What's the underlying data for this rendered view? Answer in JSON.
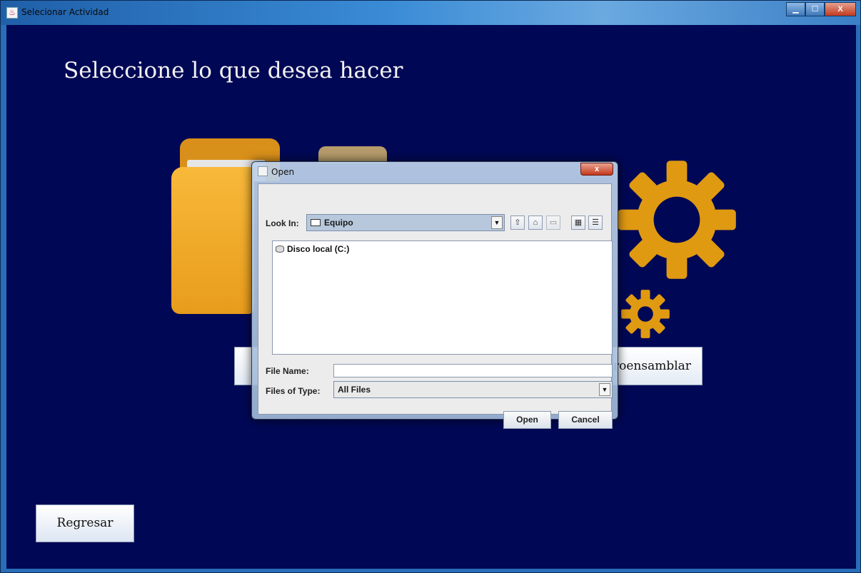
{
  "window": {
    "title": "Selecionar Actividad",
    "controls": {
      "minimize": "▁",
      "maximize": "☐",
      "close": "X"
    }
  },
  "main": {
    "heading": "Seleccione lo que desea hacer",
    "option_right_label": "roensamblar",
    "back_button_label": "Regresar"
  },
  "dialog": {
    "title": "Open",
    "close_label": "x",
    "look_in_label": "Look In:",
    "look_in_value": "Equipo",
    "files": [
      {
        "name": "Disco local (C:)"
      }
    ],
    "file_name_label": "File Name:",
    "file_name_value": "",
    "files_of_type_label": "Files of Type:",
    "files_of_type_value": "All Files",
    "open_button": "Open",
    "cancel_button": "Cancel"
  },
  "colors": {
    "background": "#000855",
    "folder": "#f3aa2a",
    "gear": "#e09a12",
    "heading_text": "#f2f2f2"
  }
}
